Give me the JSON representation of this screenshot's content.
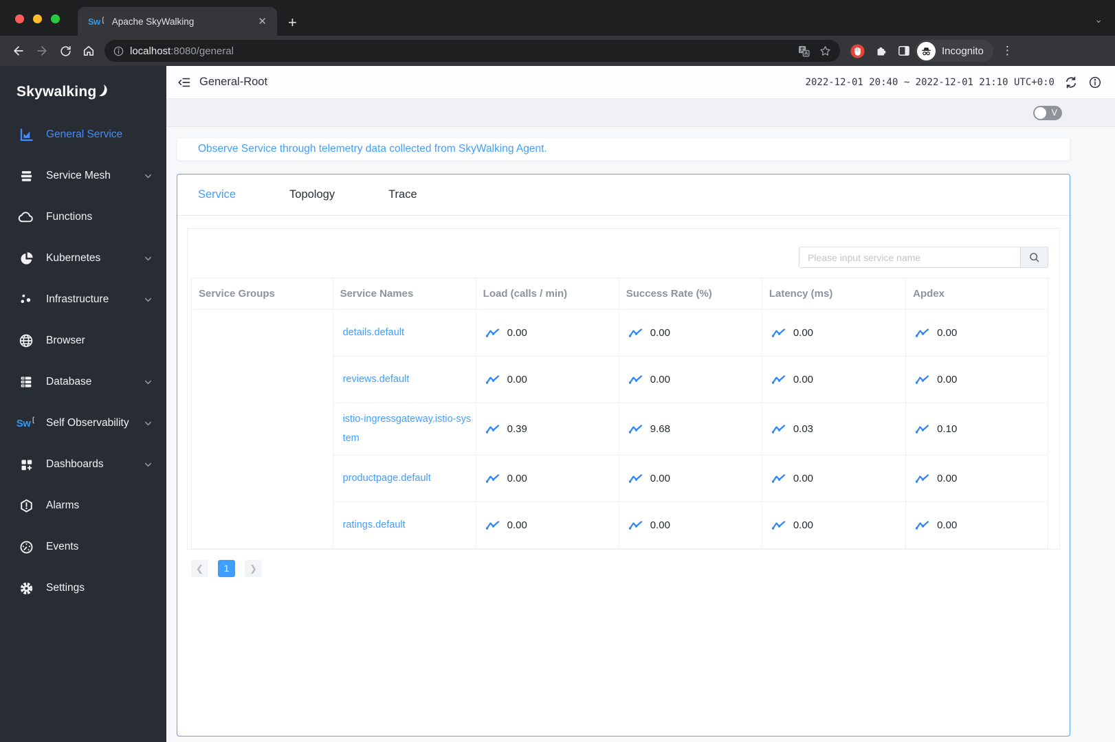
{
  "browser": {
    "tab_title": "Apache SkyWalking",
    "favicon_text": "Sw",
    "url_host": "localhost",
    "url_path": ":8080/general",
    "incognito_label": "Incognito",
    "icons": [
      "back-icon",
      "forward-icon",
      "reload-icon",
      "home-icon",
      "site-info-icon",
      "translate-icon",
      "bookmark-star-icon",
      "adblock-hand-icon",
      "extensions-puzzle-icon",
      "side-panel-icon",
      "incognito-icon",
      "menu-kebab-icon",
      "tab-close-icon",
      "new-tab-icon",
      "tabstrip-chevron-icon"
    ]
  },
  "header": {
    "title": "General-Root",
    "time_range": "2022-12-01 20:40 ~ 2022-12-01 21:10",
    "timezone": "UTC+0:0",
    "icons": [
      "fold-menu-icon",
      "auto-refresh-icon",
      "info-icon"
    ]
  },
  "version_toggle": {
    "label": "V"
  },
  "sidebar": {
    "logo": "Skywalking",
    "items": [
      {
        "label": "General Service",
        "icon": "bar-chart-icon",
        "active": true,
        "expandable": false
      },
      {
        "label": "Service Mesh",
        "icon": "layers-icon",
        "active": false,
        "expandable": true
      },
      {
        "label": "Functions",
        "icon": "cloud-icon",
        "active": false,
        "expandable": false
      },
      {
        "label": "Kubernetes",
        "icon": "pie-chart-icon",
        "active": false,
        "expandable": true
      },
      {
        "label": "Infrastructure",
        "icon": "dots-icon",
        "active": false,
        "expandable": true
      },
      {
        "label": "Browser",
        "icon": "globe-icon",
        "active": false,
        "expandable": false
      },
      {
        "label": "Database",
        "icon": "server-icon",
        "active": false,
        "expandable": true
      },
      {
        "label": "Self Observability",
        "icon": "sw-logo-icon",
        "active": false,
        "expandable": true
      },
      {
        "label": "Dashboards",
        "icon": "grid-plus-icon",
        "active": false,
        "expandable": true
      },
      {
        "label": "Alarms",
        "icon": "hexagon-alert-icon",
        "active": false,
        "expandable": false
      },
      {
        "label": "Events",
        "icon": "stopwatch-icon",
        "active": false,
        "expandable": false
      },
      {
        "label": "Settings",
        "icon": "gear-icon",
        "active": false,
        "expandable": false
      }
    ]
  },
  "banner": {
    "text": "Observe Service through telemetry data collected from SkyWalking Agent."
  },
  "tabs": [
    {
      "label": "Service",
      "active": true
    },
    {
      "label": "Topology",
      "active": false
    },
    {
      "label": "Trace",
      "active": false
    }
  ],
  "search": {
    "placeholder": "Please input service name"
  },
  "table": {
    "columns": [
      "Service Groups",
      "Service Names",
      "Load (calls / min)",
      "Success Rate (%)",
      "Latency (ms)",
      "Apdex"
    ],
    "rows": [
      {
        "group": "",
        "name": "details.default",
        "load": "0.00",
        "success_rate": "0.00",
        "latency": "0.00",
        "apdex": "0.00"
      },
      {
        "group": "",
        "name": "reviews.default",
        "load": "0.00",
        "success_rate": "0.00",
        "latency": "0.00",
        "apdex": "0.00"
      },
      {
        "group": "",
        "name": "istio-ingressgateway.istio-system",
        "load": "0.39",
        "success_rate": "9.68",
        "latency": "0.03",
        "apdex": "0.10"
      },
      {
        "group": "",
        "name": "productpage.default",
        "load": "0.00",
        "success_rate": "0.00",
        "latency": "0.00",
        "apdex": "0.00"
      },
      {
        "group": "",
        "name": "ratings.default",
        "load": "0.00",
        "success_rate": "0.00",
        "latency": "0.00",
        "apdex": "0.00"
      }
    ]
  },
  "pagination": {
    "current_page": "1"
  },
  "colors": {
    "accent": "#409eff",
    "sidebar_active": "#448dfe",
    "card_border": "#57a3f8",
    "sidebar_bg": "#272d33"
  }
}
